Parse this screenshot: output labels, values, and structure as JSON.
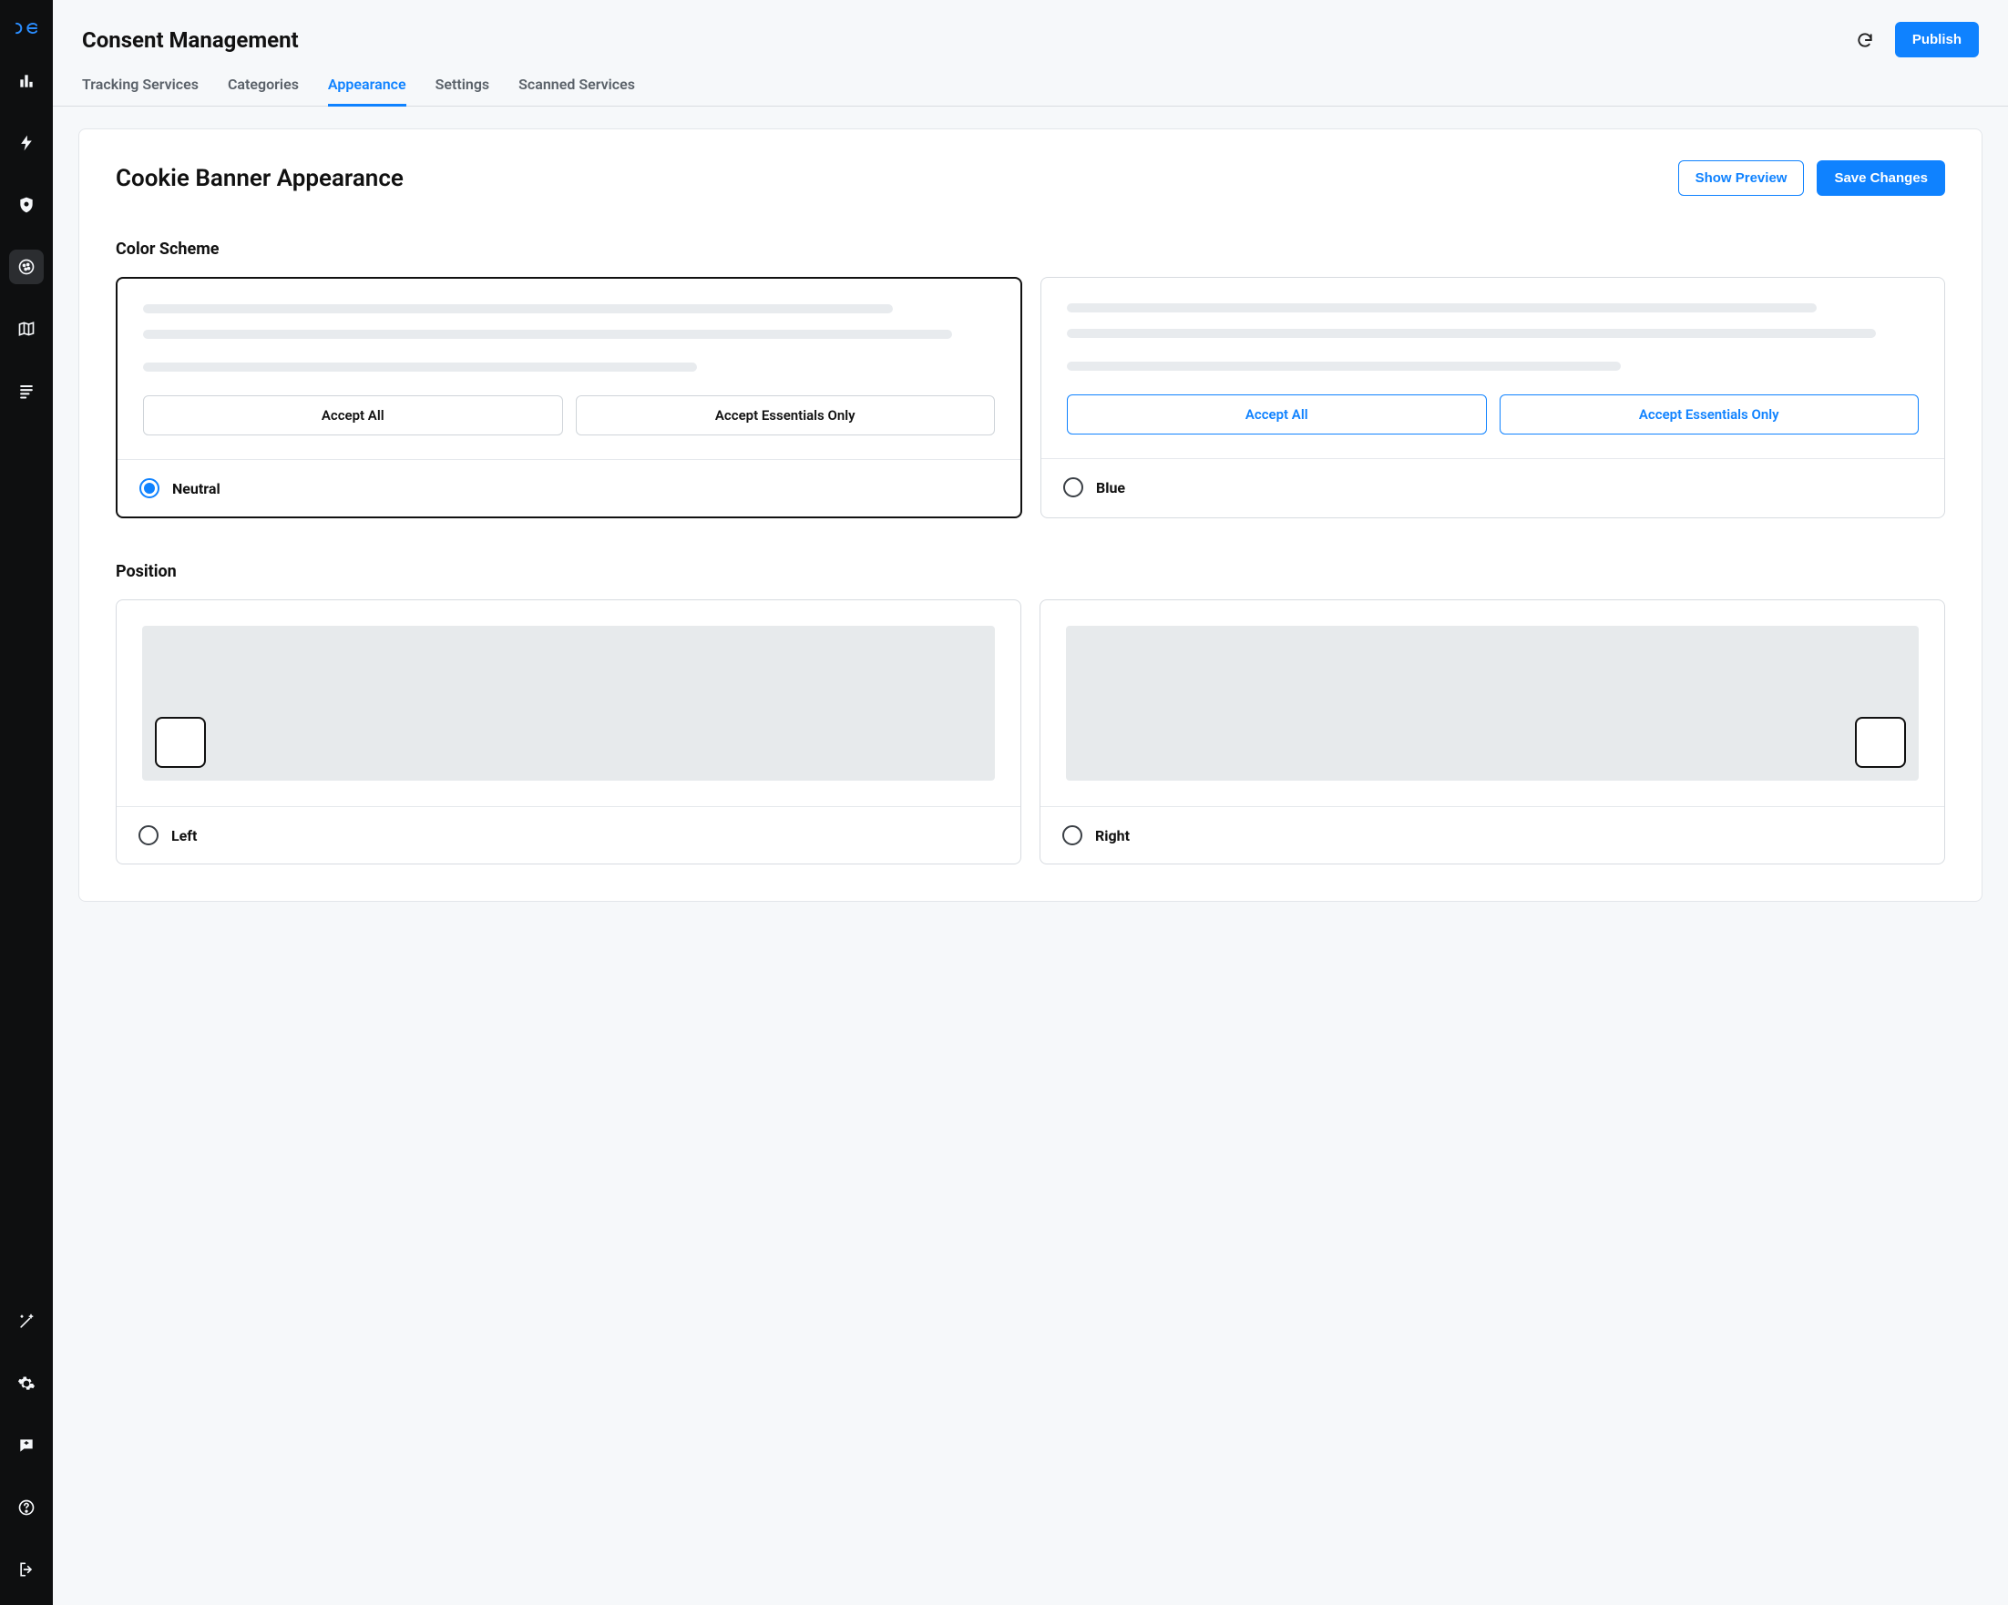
{
  "header": {
    "page_title": "Consent Management",
    "publish_label": "Publish"
  },
  "tabs": [
    {
      "label": "Tracking Services",
      "active": false
    },
    {
      "label": "Categories",
      "active": false
    },
    {
      "label": "Appearance",
      "active": true
    },
    {
      "label": "Settings",
      "active": false
    },
    {
      "label": "Scanned Services",
      "active": false
    }
  ],
  "card": {
    "title": "Cookie Banner Appearance",
    "show_preview": "Show Preview",
    "save_changes": "Save Changes"
  },
  "color_scheme": {
    "title": "Color Scheme",
    "accept_all": "Accept All",
    "accept_essentials": "Accept Essentials Only",
    "options": [
      {
        "label": "Neutral",
        "selected": true
      },
      {
        "label": "Blue",
        "selected": false
      }
    ]
  },
  "position": {
    "title": "Position",
    "options": [
      {
        "label": "Left",
        "selected": false
      },
      {
        "label": "Right",
        "selected": false
      }
    ]
  },
  "colors": {
    "primary": "#0f82ff"
  },
  "sidebar_icons": {
    "logo": "dg-logo",
    "top": [
      "analytics",
      "bolt",
      "security",
      "cookie",
      "map",
      "list"
    ],
    "bottom": [
      "magic",
      "settings",
      "feedback",
      "help",
      "logout"
    ],
    "active": "cookie"
  }
}
